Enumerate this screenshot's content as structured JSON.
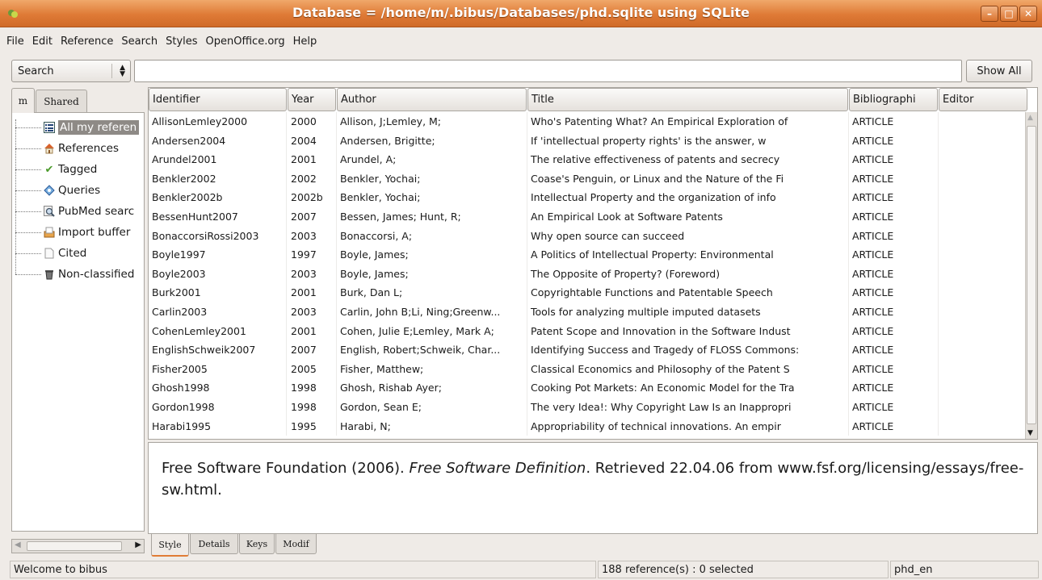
{
  "window": {
    "title": "Database = /home/m/.bibus/Databases/phd.sqlite using SQLite",
    "buttons": [
      "minimize-icon",
      "maximize-icon",
      "close-icon"
    ]
  },
  "menu": [
    "File",
    "Edit",
    "Reference",
    "Search",
    "Styles",
    "OpenOffice.org",
    "Help"
  ],
  "search": {
    "mode": "Search",
    "value": "",
    "show_all_label": "Show All"
  },
  "left_tabs": [
    "m",
    "Shared"
  ],
  "tree": [
    {
      "label": "All my referen",
      "icon": "list-icon",
      "selected": true
    },
    {
      "label": "References",
      "icon": "home-icon"
    },
    {
      "label": "Tagged",
      "icon": "checkmark-icon"
    },
    {
      "label": "Queries",
      "icon": "diamond-icon"
    },
    {
      "label": "PubMed searc",
      "icon": "magnifier-icon"
    },
    {
      "label": "Import buffer",
      "icon": "inbox-icon"
    },
    {
      "label": "Cited",
      "icon": "document-icon"
    },
    {
      "label": "Non-classified",
      "icon": "trash-icon"
    }
  ],
  "table": {
    "columns": [
      "Identifier",
      "Year",
      "Author",
      "Title",
      "Bibliographi",
      "Editor"
    ],
    "rows": [
      [
        "AllisonLemley2000",
        "2000",
        "Allison, J;Lemley, M;",
        "Who's Patenting What? An Empirical Exploration of",
        "ARTICLE",
        ""
      ],
      [
        "Andersen2004",
        "2004",
        "Andersen, Brigitte;",
        "If 'intellectual property rights' is the answer, w",
        "ARTICLE",
        ""
      ],
      [
        "Arundel2001",
        "2001",
        "Arundel, A;",
        "The relative effectiveness of patents and secrecy",
        "ARTICLE",
        ""
      ],
      [
        "Benkler2002",
        "2002",
        "Benkler, Yochai;",
        "Coase's Penguin, or Linux and the Nature of the Fi",
        "ARTICLE",
        ""
      ],
      [
        "Benkler2002b",
        "2002b",
        "Benkler, Yochai;",
        "Intellectual Property and the organization of info",
        "ARTICLE",
        ""
      ],
      [
        "BessenHunt2007",
        "2007",
        "Bessen, James; Hunt, R;",
        "An Empirical Look at Software Patents",
        "ARTICLE",
        ""
      ],
      [
        "BonaccorsiRossi2003",
        "2003",
        "Bonaccorsi, A;",
        "Why open source can succeed",
        "ARTICLE",
        ""
      ],
      [
        "Boyle1997",
        "1997",
        "Boyle, James;",
        "A Politics of Intellectual Property: Environmental",
        "ARTICLE",
        ""
      ],
      [
        "Boyle2003",
        "2003",
        "Boyle, James;",
        "The Opposite of Property? (Foreword)",
        "ARTICLE",
        ""
      ],
      [
        "Burk2001",
        "2001",
        "Burk, Dan L;",
        "Copyrightable Functions and Patentable Speech",
        "ARTICLE",
        ""
      ],
      [
        "Carlin2003",
        "2003",
        "Carlin, John B;Li, Ning;Greenw...",
        "Tools for analyzing multiple imputed datasets",
        "ARTICLE",
        ""
      ],
      [
        "CohenLemley2001",
        "2001",
        "Cohen, Julie E;Lemley, Mark A;",
        "Patent Scope and Innovation in the Software Indust",
        "ARTICLE",
        ""
      ],
      [
        "EnglishSchweik2007",
        "2007",
        "English, Robert;Schweik, Char...",
        "Identifying Success and Tragedy of FLOSS Commons:",
        "ARTICLE",
        ""
      ],
      [
        "Fisher2005",
        "2005",
        "Fisher, Matthew;",
        "Classical Economics and Philosophy of the Patent S",
        "ARTICLE",
        ""
      ],
      [
        "Ghosh1998",
        "1998",
        "Ghosh, Rishab Ayer;",
        "Cooking Pot Markets: An Economic Model for the Tra",
        "ARTICLE",
        ""
      ],
      [
        "Gordon1998",
        "1998",
        "Gordon, Sean E;",
        "The very Idea!: Why Copyright Law Is an Inappropri",
        "ARTICLE",
        ""
      ],
      [
        "Harabi1995",
        "1995",
        "Harabi, N;",
        "Appropriability of technical innovations. An empir",
        "ARTICLE",
        ""
      ]
    ]
  },
  "preview": {
    "before": "Free Software Foundation (2006). ",
    "title_italic": "Free Software Definition",
    "after": ". Retrieved 22.04.06 from www.fsf.org/licensing/essays/free-sw.html."
  },
  "bottom_tabs": [
    "Style",
    "Details",
    "Keys",
    "Modif"
  ],
  "status": {
    "message": "Welcome to bibus",
    "count": "188 reference(s) : 0 selected",
    "style": "phd_en"
  },
  "colors": {
    "titlebar": "#df7a36",
    "selection": "#8e8a86",
    "accent": "#e07c35"
  }
}
